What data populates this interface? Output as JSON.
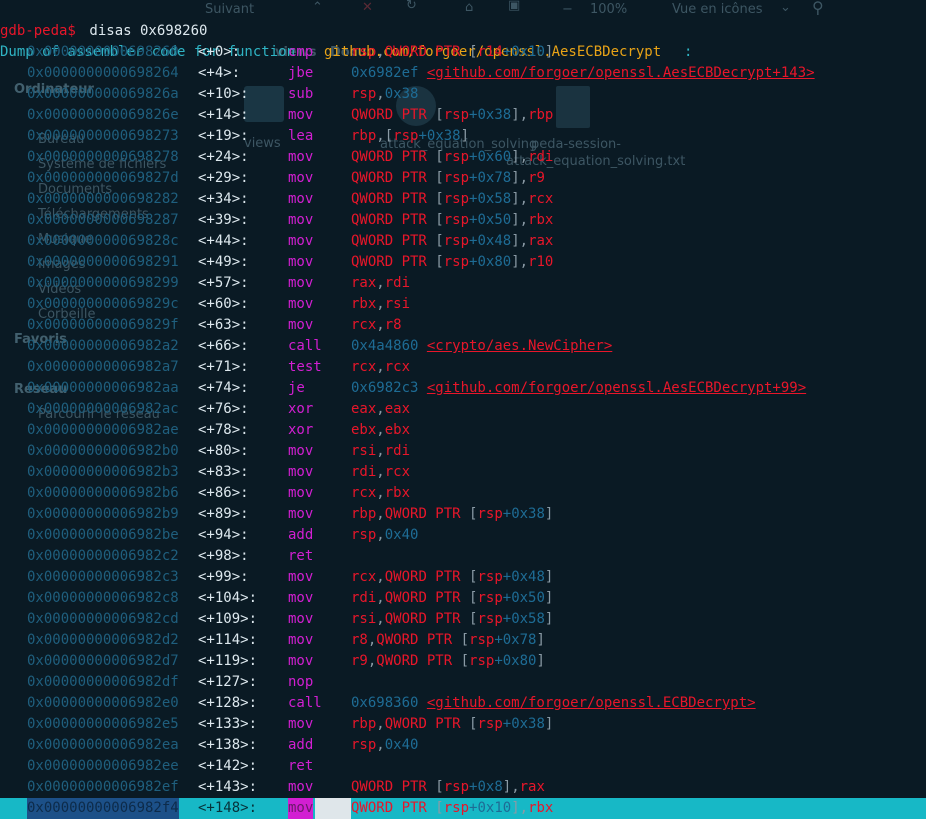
{
  "terminal": {
    "prompt": "gdb-peda$",
    "command": " disas 0x698260",
    "header_text": "Dump of assembler code for function ",
    "header_function": "github.com/forgoer/openssl.AesECBDecrypt",
    "header_colon": ":",
    "current_line_index": 36,
    "colors": {
      "background": "#0a1a24",
      "address": "#1f5f7e",
      "mnemonic": "#d21fd2",
      "register": "#e8162a",
      "number": "#1e6c95",
      "highlight_bar": "#17b8c6",
      "prompt": "#e8162a",
      "function_name": "#e8a317"
    },
    "lines": [
      {
        "addr": "0x0000000000698260",
        "off": "<+0>:",
        "mn": "cmp",
        "ops": [
          [
            "r",
            "rsp"
          ],
          [
            "g",
            ","
          ],
          [
            "r",
            "QWORD PTR "
          ],
          [
            "g",
            "["
          ],
          [
            "r",
            "r14"
          ],
          [
            "b",
            "+"
          ],
          [
            "b",
            "0x10"
          ],
          [
            "g",
            "]"
          ]
        ]
      },
      {
        "addr": "0x0000000000698264",
        "off": "<+4>:",
        "mn": "jbe",
        "ops": [
          [
            "b",
            "0x6982ef "
          ],
          [
            "ul",
            "<github.com/forgoer/openssl.AesECBDecrypt+143>"
          ]
        ]
      },
      {
        "addr": "0x000000000069826a",
        "off": "<+10>:",
        "mn": "sub",
        "ops": [
          [
            "r",
            "rsp"
          ],
          [
            "g",
            ","
          ],
          [
            "b",
            "0x38"
          ]
        ]
      },
      {
        "addr": "0x000000000069826e",
        "off": "<+14>:",
        "mn": "mov",
        "ops": [
          [
            "r",
            "QWORD PTR "
          ],
          [
            "g",
            "["
          ],
          [
            "r",
            "rsp"
          ],
          [
            "b",
            "+0x38"
          ],
          [
            "g",
            "]"
          ],
          [
            "g",
            ","
          ],
          [
            "r",
            "rbp"
          ]
        ]
      },
      {
        "addr": "0x0000000000698273",
        "off": "<+19>:",
        "mn": "lea",
        "ops": [
          [
            "r",
            "rbp"
          ],
          [
            "g",
            ","
          ],
          [
            "g",
            "["
          ],
          [
            "r",
            "rsp"
          ],
          [
            "b",
            "+0x38"
          ],
          [
            "g",
            "]"
          ]
        ]
      },
      {
        "addr": "0x0000000000698278",
        "off": "<+24>:",
        "mn": "mov",
        "ops": [
          [
            "r",
            "QWORD PTR "
          ],
          [
            "g",
            "["
          ],
          [
            "r",
            "rsp"
          ],
          [
            "b",
            "+0x60"
          ],
          [
            "g",
            "]"
          ],
          [
            "g",
            ","
          ],
          [
            "r",
            "rdi"
          ]
        ]
      },
      {
        "addr": "0x000000000069827d",
        "off": "<+29>:",
        "mn": "mov",
        "ops": [
          [
            "r",
            "QWORD PTR "
          ],
          [
            "g",
            "["
          ],
          [
            "r",
            "rsp"
          ],
          [
            "b",
            "+0x78"
          ],
          [
            "g",
            "]"
          ],
          [
            "g",
            ","
          ],
          [
            "r",
            "r9"
          ]
        ]
      },
      {
        "addr": "0x0000000000698282",
        "off": "<+34>:",
        "mn": "mov",
        "ops": [
          [
            "r",
            "QWORD PTR "
          ],
          [
            "g",
            "["
          ],
          [
            "r",
            "rsp"
          ],
          [
            "b",
            "+0x58"
          ],
          [
            "g",
            "]"
          ],
          [
            "g",
            ","
          ],
          [
            "r",
            "rcx"
          ]
        ]
      },
      {
        "addr": "0x0000000000698287",
        "off": "<+39>:",
        "mn": "mov",
        "ops": [
          [
            "r",
            "QWORD PTR "
          ],
          [
            "g",
            "["
          ],
          [
            "r",
            "rsp"
          ],
          [
            "b",
            "+0x50"
          ],
          [
            "g",
            "]"
          ],
          [
            "g",
            ","
          ],
          [
            "r",
            "rbx"
          ]
        ]
      },
      {
        "addr": "0x000000000069828c",
        "off": "<+44>:",
        "mn": "mov",
        "ops": [
          [
            "r",
            "QWORD PTR "
          ],
          [
            "g",
            "["
          ],
          [
            "r",
            "rsp"
          ],
          [
            "b",
            "+0x48"
          ],
          [
            "g",
            "]"
          ],
          [
            "g",
            ","
          ],
          [
            "r",
            "rax"
          ]
        ]
      },
      {
        "addr": "0x0000000000698291",
        "off": "<+49>:",
        "mn": "mov",
        "ops": [
          [
            "r",
            "QWORD PTR "
          ],
          [
            "g",
            "["
          ],
          [
            "r",
            "rsp"
          ],
          [
            "b",
            "+0x80"
          ],
          [
            "g",
            "]"
          ],
          [
            "g",
            ","
          ],
          [
            "r",
            "r10"
          ]
        ]
      },
      {
        "addr": "0x0000000000698299",
        "off": "<+57>:",
        "mn": "mov",
        "ops": [
          [
            "r",
            "rax"
          ],
          [
            "g",
            ","
          ],
          [
            "r",
            "rdi"
          ]
        ]
      },
      {
        "addr": "0x000000000069829c",
        "off": "<+60>:",
        "mn": "mov",
        "ops": [
          [
            "r",
            "rbx"
          ],
          [
            "g",
            ","
          ],
          [
            "r",
            "rsi"
          ]
        ]
      },
      {
        "addr": "0x000000000069829f",
        "off": "<+63>:",
        "mn": "mov",
        "ops": [
          [
            "r",
            "rcx"
          ],
          [
            "g",
            ","
          ],
          [
            "r",
            "r8"
          ]
        ]
      },
      {
        "addr": "0x00000000006982a2",
        "off": "<+66>:",
        "mn": "call",
        "ops": [
          [
            "b",
            "0x4a4860 "
          ],
          [
            "ul",
            "<crypto/aes.NewCipher>"
          ]
        ]
      },
      {
        "addr": "0x00000000006982a7",
        "off": "<+71>:",
        "mn": "test",
        "ops": [
          [
            "r",
            "rcx"
          ],
          [
            "g",
            ","
          ],
          [
            "r",
            "rcx"
          ]
        ]
      },
      {
        "addr": "0x00000000006982aa",
        "off": "<+74>:",
        "mn": "je",
        "ops": [
          [
            "b",
            "0x6982c3 "
          ],
          [
            "ul",
            "<github.com/forgoer/openssl.AesECBDecrypt+99>"
          ]
        ]
      },
      {
        "addr": "0x00000000006982ac",
        "off": "<+76>:",
        "mn": "xor",
        "ops": [
          [
            "r",
            "eax"
          ],
          [
            "g",
            ","
          ],
          [
            "r",
            "eax"
          ]
        ]
      },
      {
        "addr": "0x00000000006982ae",
        "off": "<+78>:",
        "mn": "xor",
        "ops": [
          [
            "r",
            "ebx"
          ],
          [
            "g",
            ","
          ],
          [
            "r",
            "ebx"
          ]
        ]
      },
      {
        "addr": "0x00000000006982b0",
        "off": "<+80>:",
        "mn": "mov",
        "ops": [
          [
            "r",
            "rsi"
          ],
          [
            "g",
            ","
          ],
          [
            "r",
            "rdi"
          ]
        ]
      },
      {
        "addr": "0x00000000006982b3",
        "off": "<+83>:",
        "mn": "mov",
        "ops": [
          [
            "r",
            "rdi"
          ],
          [
            "g",
            ","
          ],
          [
            "r",
            "rcx"
          ]
        ]
      },
      {
        "addr": "0x00000000006982b6",
        "off": "<+86>:",
        "mn": "mov",
        "ops": [
          [
            "r",
            "rcx"
          ],
          [
            "g",
            ","
          ],
          [
            "r",
            "rbx"
          ]
        ]
      },
      {
        "addr": "0x00000000006982b9",
        "off": "<+89>:",
        "mn": "mov",
        "ops": [
          [
            "r",
            "rbp"
          ],
          [
            "g",
            ","
          ],
          [
            "r",
            "QWORD PTR "
          ],
          [
            "g",
            "["
          ],
          [
            "r",
            "rsp"
          ],
          [
            "b",
            "+0x38"
          ],
          [
            "g",
            "]"
          ]
        ]
      },
      {
        "addr": "0x00000000006982be",
        "off": "<+94>:",
        "mn": "add",
        "ops": [
          [
            "r",
            "rsp"
          ],
          [
            "g",
            ","
          ],
          [
            "b",
            "0x40"
          ]
        ]
      },
      {
        "addr": "0x00000000006982c2",
        "off": "<+98>:",
        "mn": "ret",
        "ops": []
      },
      {
        "addr": "0x00000000006982c3",
        "off": "<+99>:",
        "mn": "mov",
        "ops": [
          [
            "r",
            "rcx"
          ],
          [
            "g",
            ","
          ],
          [
            "r",
            "QWORD PTR "
          ],
          [
            "g",
            "["
          ],
          [
            "r",
            "rsp"
          ],
          [
            "b",
            "+0x48"
          ],
          [
            "g",
            "]"
          ]
        ]
      },
      {
        "addr": "0x00000000006982c8",
        "off": "<+104>:",
        "mn": "mov",
        "ops": [
          [
            "r",
            "rdi"
          ],
          [
            "g",
            ","
          ],
          [
            "r",
            "QWORD PTR "
          ],
          [
            "g",
            "["
          ],
          [
            "r",
            "rsp"
          ],
          [
            "b",
            "+0x50"
          ],
          [
            "g",
            "]"
          ]
        ]
      },
      {
        "addr": "0x00000000006982cd",
        "off": "<+109>:",
        "mn": "mov",
        "ops": [
          [
            "r",
            "rsi"
          ],
          [
            "g",
            ","
          ],
          [
            "r",
            "QWORD PTR "
          ],
          [
            "g",
            "["
          ],
          [
            "r",
            "rsp"
          ],
          [
            "b",
            "+0x58"
          ],
          [
            "g",
            "]"
          ]
        ]
      },
      {
        "addr": "0x00000000006982d2",
        "off": "<+114>:",
        "mn": "mov",
        "ops": [
          [
            "r",
            "r8"
          ],
          [
            "g",
            ","
          ],
          [
            "r",
            "QWORD PTR "
          ],
          [
            "g",
            "["
          ],
          [
            "r",
            "rsp"
          ],
          [
            "b",
            "+0x78"
          ],
          [
            "g",
            "]"
          ]
        ]
      },
      {
        "addr": "0x00000000006982d7",
        "off": "<+119>:",
        "mn": "mov",
        "ops": [
          [
            "r",
            "r9"
          ],
          [
            "g",
            ","
          ],
          [
            "r",
            "QWORD PTR "
          ],
          [
            "g",
            "["
          ],
          [
            "r",
            "rsp"
          ],
          [
            "b",
            "+0x80"
          ],
          [
            "g",
            "]"
          ]
        ]
      },
      {
        "addr": "0x00000000006982df",
        "off": "<+127>:",
        "mn": "nop",
        "ops": []
      },
      {
        "addr": "0x00000000006982e0",
        "off": "<+128>:",
        "mn": "call",
        "ops": [
          [
            "b",
            "0x698360 "
          ],
          [
            "ul",
            "<github.com/forgoer/openssl.ECBDecrypt>"
          ]
        ]
      },
      {
        "addr": "0x00000000006982e5",
        "off": "<+133>:",
        "mn": "mov",
        "ops": [
          [
            "r",
            "rbp"
          ],
          [
            "g",
            ","
          ],
          [
            "r",
            "QWORD PTR "
          ],
          [
            "g",
            "["
          ],
          [
            "r",
            "rsp"
          ],
          [
            "b",
            "+0x38"
          ],
          [
            "g",
            "]"
          ]
        ]
      },
      {
        "addr": "0x00000000006982ea",
        "off": "<+138>:",
        "mn": "add",
        "ops": [
          [
            "r",
            "rsp"
          ],
          [
            "g",
            ","
          ],
          [
            "b",
            "0x40"
          ]
        ]
      },
      {
        "addr": "0x00000000006982ee",
        "off": "<+142>:",
        "mn": "ret",
        "ops": []
      },
      {
        "addr": "0x00000000006982ef",
        "off": "<+143>:",
        "mn": "mov",
        "ops": [
          [
            "r",
            "QWORD PTR "
          ],
          [
            "g",
            "["
          ],
          [
            "r",
            "rsp"
          ],
          [
            "b",
            "+0x8"
          ],
          [
            "g",
            "]"
          ],
          [
            "g",
            ","
          ],
          [
            "r",
            "rax"
          ]
        ]
      },
      {
        "addr": "0x00000000006982f4",
        "off": "<+148>:",
        "mn": "mov",
        "ops": [
          [
            "r",
            "QWORD PTR "
          ],
          [
            "g",
            "["
          ],
          [
            "r",
            "rsp"
          ],
          [
            "b",
            "+0x10"
          ],
          [
            "g",
            "]"
          ],
          [
            "g",
            ","
          ],
          [
            "r",
            "rbx"
          ]
        ]
      }
    ]
  },
  "background_window": {
    "toolbar": {
      "suivant_label": "Suivant",
      "zoom_label": "100%",
      "view_mode_label": "Vue en icônes",
      "path_partial_1": "views",
      "path_partial_2": "Docu"
    },
    "sidebar": {
      "ordinateur_heading": "Ordinateur",
      "ordinateur_items": [
        "Bureau",
        "Système de fichiers",
        "Documents",
        "Téléchargements",
        "Musique",
        "Images",
        "Vidéos",
        "Corbeille"
      ],
      "favoris_heading": "Favoris",
      "reseau_heading": "Réseau",
      "reseau_items": [
        "Parcourir le réseau"
      ]
    },
    "files": [
      {
        "name": "views",
        "icon": "folder-icon"
      },
      {
        "name": "attack_equation_solving",
        "icon": "gear-file-icon"
      },
      {
        "name": "peda-session-attack_equation_solving.txt",
        "icon": "text-file-icon"
      }
    ]
  }
}
